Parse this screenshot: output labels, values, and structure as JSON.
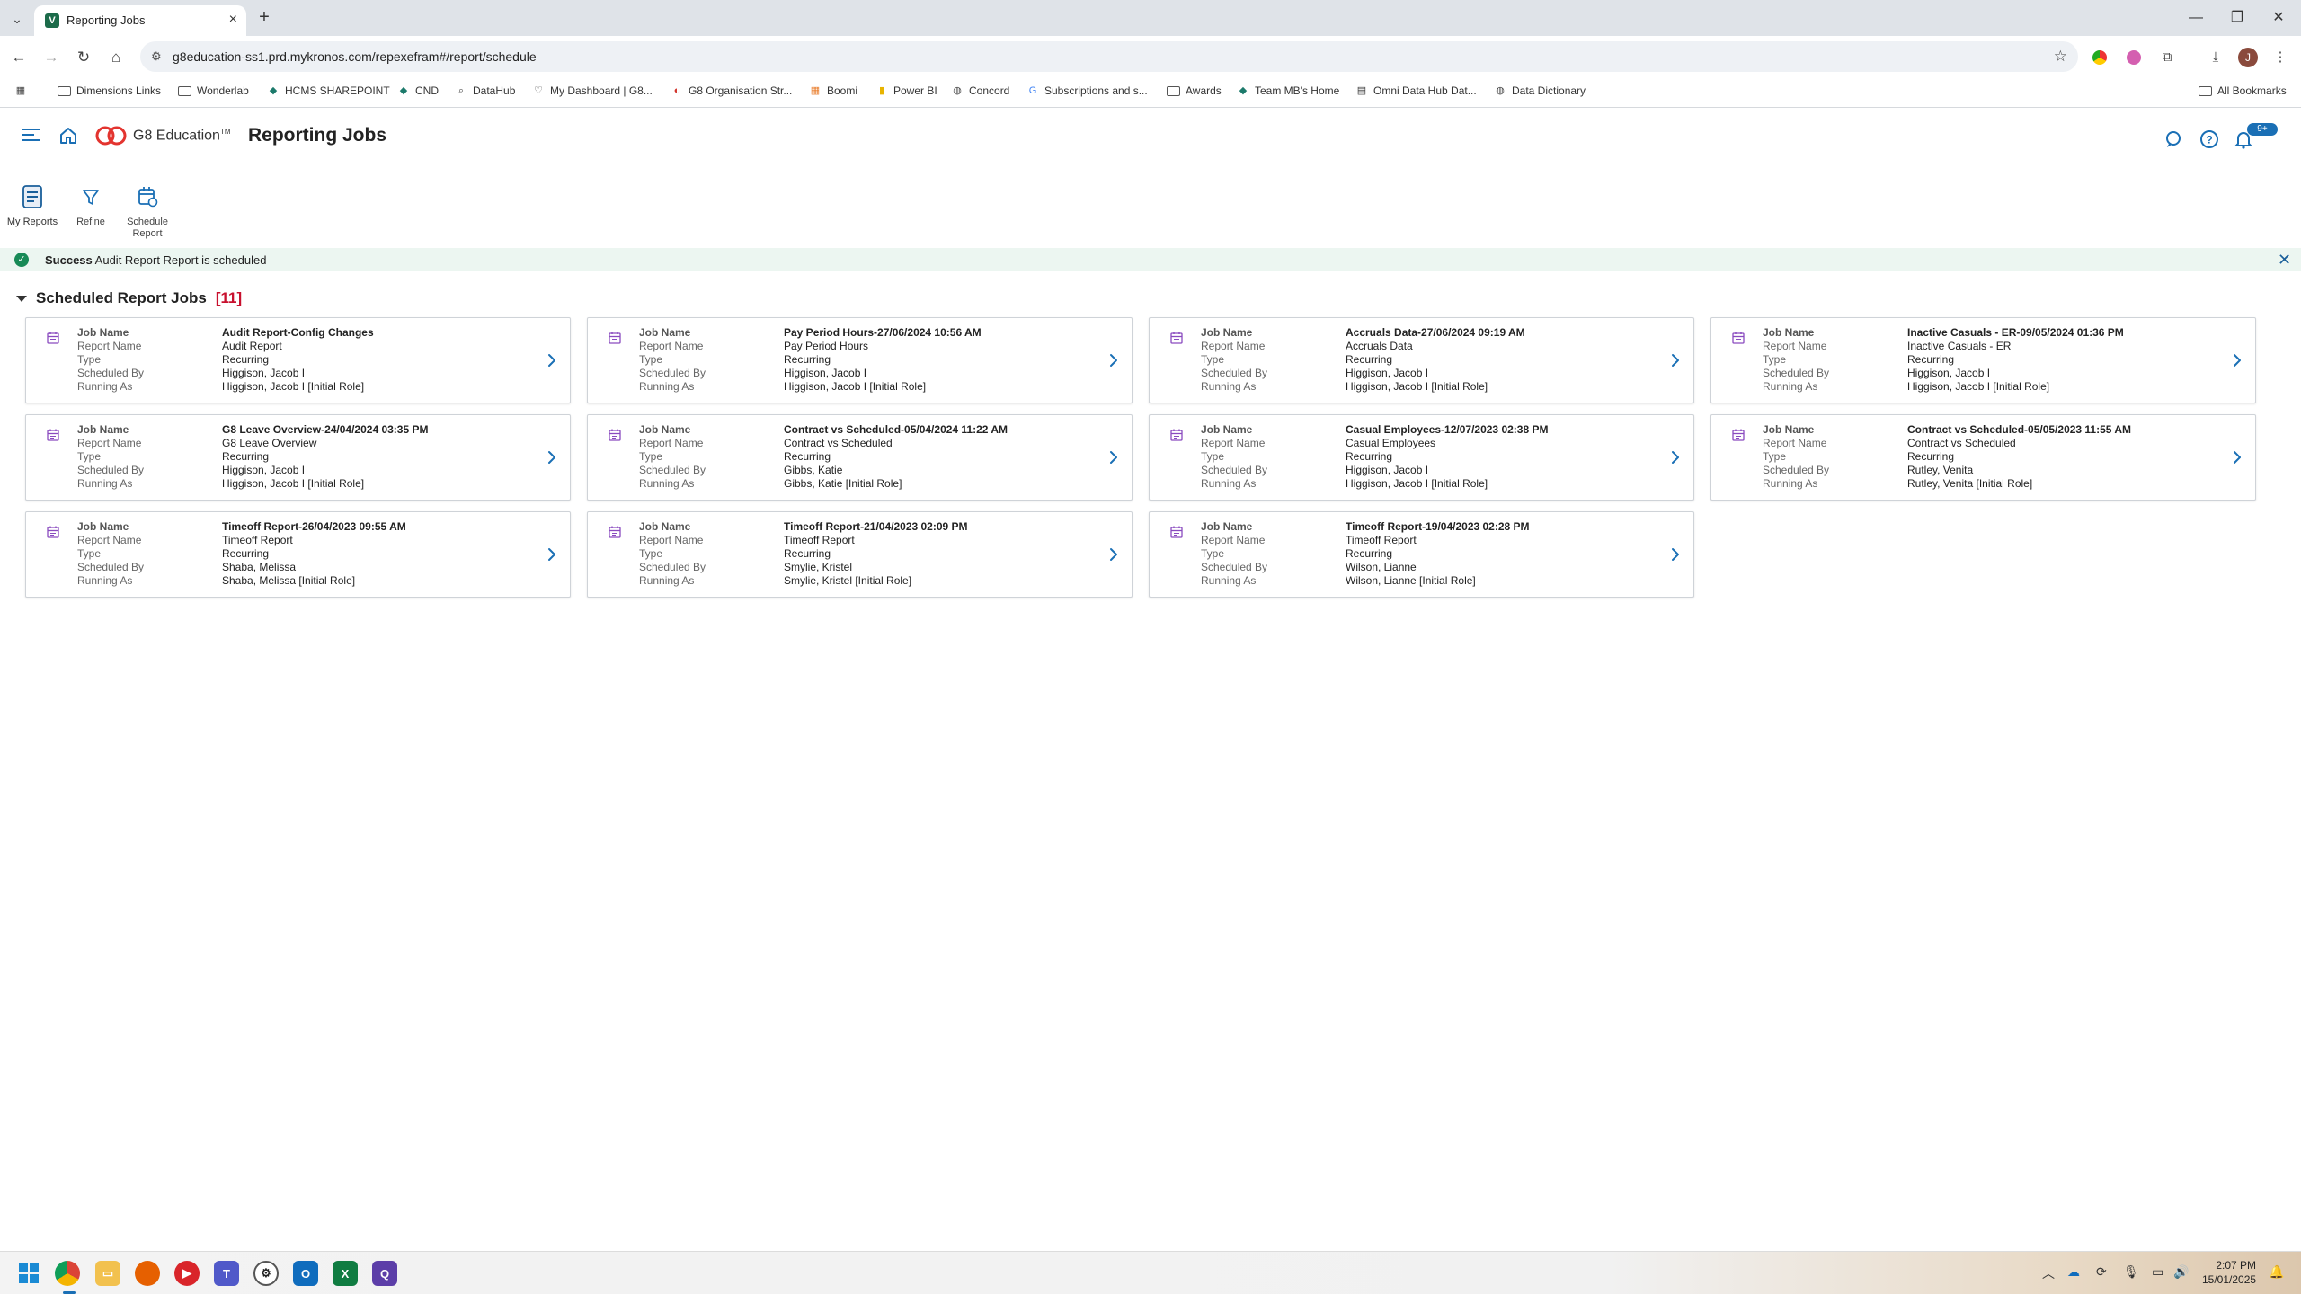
{
  "browser": {
    "tab_title": "Reporting Jobs",
    "tab_favicon": "V",
    "url": "g8education-ss1.prd.mykronos.com/repexefram#/report/schedule",
    "profile_initial": "J",
    "bookmarks": [
      {
        "label": "Dimensions Links",
        "icon": "folder-icon"
      },
      {
        "label": "Wonderlab",
        "icon": "folder-icon"
      },
      {
        "label": "HCMS SHAREPOINT",
        "icon": "sharepoint-icon"
      },
      {
        "label": "CND",
        "icon": "sharepoint-icon"
      },
      {
        "label": "DataHub",
        "icon": "search-icon"
      },
      {
        "label": "My Dashboard | G8...",
        "icon": "dashboard-icon"
      },
      {
        "label": "G8 Organisation Str...",
        "icon": "org-icon"
      },
      {
        "label": "Boomi",
        "icon": "grid-icon"
      },
      {
        "label": "Power BI",
        "icon": "powerbi-icon"
      },
      {
        "label": "Concord",
        "icon": "globe-icon"
      },
      {
        "label": "Subscriptions and s...",
        "icon": "google-icon"
      },
      {
        "label": "Awards",
        "icon": "folder-icon"
      },
      {
        "label": "Team MB's Home",
        "icon": "sharepoint-icon"
      },
      {
        "label": "Omni Data Hub Dat...",
        "icon": "doc-icon"
      },
      {
        "label": "Data Dictionary",
        "icon": "globe-icon"
      }
    ],
    "all_bookmarks": "All Bookmarks"
  },
  "app": {
    "logo_text": "G8 Education",
    "logo_tm": "TM",
    "title": "Reporting Jobs",
    "notification_count": "9+"
  },
  "actions": {
    "my_reports": "My Reports",
    "refine": "Refine",
    "schedule_report_line1": "Schedule",
    "schedule_report_line2": "Report"
  },
  "banner": {
    "status": "Success",
    "message": "Audit Report Report is scheduled"
  },
  "section": {
    "title": "Scheduled Report Jobs",
    "count": "[11]"
  },
  "field_labels": {
    "job_name": "Job Name",
    "report_name": "Report Name",
    "type": "Type",
    "scheduled_by": "Scheduled By",
    "running_as": "Running As"
  },
  "jobs": [
    {
      "job_name": "Audit Report-Config Changes",
      "report_name": "Audit Report",
      "type": "Recurring",
      "scheduled_by": "Higgison, Jacob I",
      "running_as": "Higgison, Jacob I [Initial Role]"
    },
    {
      "job_name": "Pay Period Hours-27/06/2024 10:56 AM",
      "report_name": "Pay Period Hours",
      "type": "Recurring",
      "scheduled_by": "Higgison, Jacob I",
      "running_as": "Higgison, Jacob I [Initial Role]"
    },
    {
      "job_name": "Accruals Data-27/06/2024 09:19 AM",
      "report_name": "Accruals Data",
      "type": "Recurring",
      "scheduled_by": "Higgison, Jacob I",
      "running_as": "Higgison, Jacob I [Initial Role]"
    },
    {
      "job_name": "Inactive Casuals - ER-09/05/2024 01:36 PM",
      "report_name": "Inactive Casuals - ER",
      "type": "Recurring",
      "scheduled_by": "Higgison, Jacob I",
      "running_as": "Higgison, Jacob I [Initial Role]"
    },
    {
      "job_name": "G8 Leave Overview-24/04/2024 03:35 PM",
      "report_name": "G8 Leave Overview",
      "type": "Recurring",
      "scheduled_by": "Higgison, Jacob I",
      "running_as": "Higgison, Jacob I [Initial Role]"
    },
    {
      "job_name": "Contract vs Scheduled-05/04/2024 11:22 AM",
      "report_name": "Contract vs Scheduled",
      "type": "Recurring",
      "scheduled_by": "Gibbs, Katie",
      "running_as": "Gibbs, Katie [Initial Role]"
    },
    {
      "job_name": "Casual Employees-12/07/2023 02:38 PM",
      "report_name": "Casual Employees",
      "type": "Recurring",
      "scheduled_by": "Higgison, Jacob I",
      "running_as": "Higgison, Jacob I [Initial Role]"
    },
    {
      "job_name": "Contract vs Scheduled-05/05/2023 11:55 AM",
      "report_name": "Contract vs Scheduled",
      "type": "Recurring",
      "scheduled_by": "Rutley, Venita",
      "running_as": "Rutley, Venita [Initial Role]"
    },
    {
      "job_name": "Timeoff Report-26/04/2023 09:55 AM",
      "report_name": "Timeoff Report",
      "type": "Recurring",
      "scheduled_by": "Shaba, Melissa",
      "running_as": "Shaba, Melissa [Initial Role]"
    },
    {
      "job_name": "Timeoff Report-21/04/2023 02:09 PM",
      "report_name": "Timeoff Report",
      "type": "Recurring",
      "scheduled_by": "Smylie, Kristel",
      "running_as": "Smylie, Kristel [Initial Role]"
    },
    {
      "job_name": "Timeoff Report-19/04/2023 02:28 PM",
      "report_name": "Timeoff Report",
      "type": "Recurring",
      "scheduled_by": "Wilson, Lianne",
      "running_as": "Wilson, Lianne [Initial Role]"
    }
  ],
  "taskbar": {
    "time": "2:07 PM",
    "date": "15/01/2025"
  },
  "colors": {
    "accent": "#1a6fb5",
    "success": "#188a57",
    "count": "#c8102e",
    "card_icon": "#8a4bbf"
  }
}
